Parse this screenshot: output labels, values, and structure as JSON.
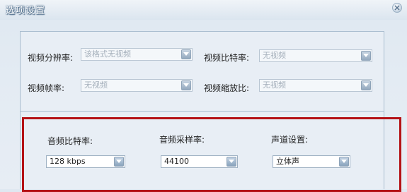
{
  "window": {
    "title": "选项设置"
  },
  "video": {
    "resolution": {
      "label": "视频分辨率:",
      "value": "该格式无视频"
    },
    "bitrate": {
      "label": "视频比特率:",
      "value": "无视频"
    },
    "framerate": {
      "label": "视频帧率:",
      "value": "无视频"
    },
    "aspect": {
      "label": "视频缩放比:",
      "value": "无视频"
    }
  },
  "audio": {
    "bitrate": {
      "label": "音频比特率:",
      "value": "128 kbps"
    },
    "samplerate": {
      "label": "音频采样率:",
      "value": "44100"
    },
    "channels": {
      "label": "声道设置:",
      "value": "立体声"
    }
  },
  "icons": {
    "close": "close-icon",
    "dropdown": "chevron-down-icon"
  },
  "colors": {
    "highlight": "#b41216",
    "panel_border": "#a9bdd0"
  }
}
